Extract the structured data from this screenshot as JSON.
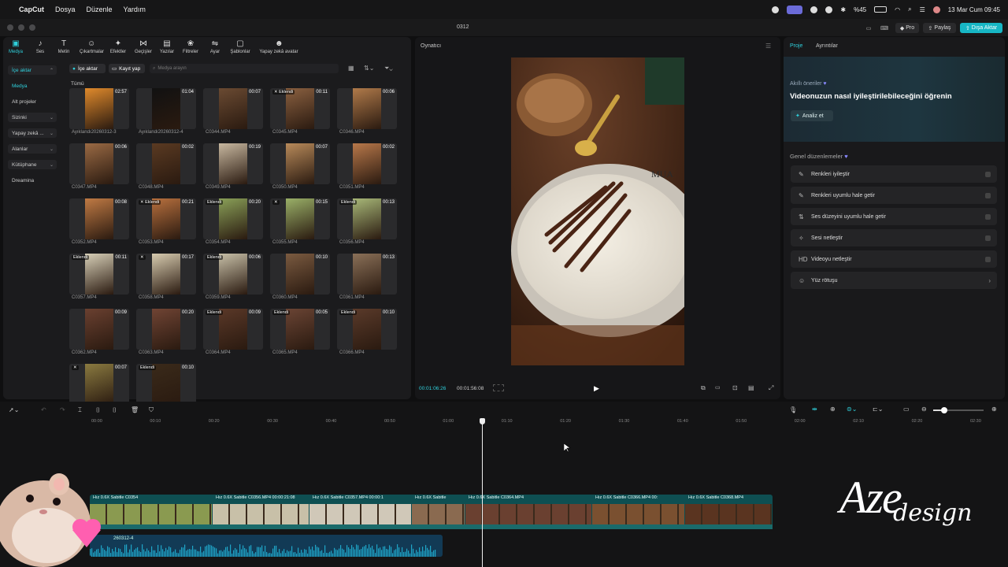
{
  "menubar": {
    "apple": "",
    "app_name": "CapCut",
    "items": [
      "Dosya",
      "Düzenle",
      "Yardım"
    ],
    "battery": "%45",
    "datetime": "13 Mar Cum  09:45"
  },
  "window": {
    "title": "0312",
    "pro_label": "Pro",
    "share_label": "Paylaş",
    "export_label": "Dışa Aktar"
  },
  "toolbar": {
    "tools": [
      {
        "label": "Medya",
        "icon": "▣"
      },
      {
        "label": "Ses",
        "icon": "♪"
      },
      {
        "label": "Metin",
        "icon": "T"
      },
      {
        "label": "Çıkartmalar",
        "icon": "☺"
      },
      {
        "label": "Efektler",
        "icon": "✦"
      },
      {
        "label": "Geçişler",
        "icon": "⋈"
      },
      {
        "label": "Yazılar",
        "icon": "▤"
      },
      {
        "label": "Filtreler",
        "icon": "❀"
      },
      {
        "label": "Ayar",
        "icon": "⇋"
      },
      {
        "label": "Şablonlar",
        "icon": "▢"
      },
      {
        "label": "Yapay zekâ avatar",
        "icon": "☻"
      }
    ]
  },
  "sidebar": {
    "items": [
      {
        "label": "İçe aktar",
        "arrow": "⌃"
      },
      {
        "label": "Medya",
        "arrow": ""
      },
      {
        "label": "Alt projeler",
        "arrow": ""
      },
      {
        "label": "Sizinki",
        "arrow": "⌄"
      },
      {
        "label": "Yapay zekâ ...",
        "arrow": "⌄"
      },
      {
        "label": "Alanlar",
        "arrow": "⌄"
      },
      {
        "label": "Kütüphane",
        "arrow": "⌄"
      },
      {
        "label": "Dreamina",
        "arrow": ""
      }
    ]
  },
  "media": {
    "import_label": "İçe aktar",
    "record_label": "Kayıt yap",
    "search_placeholder": "Medya arayın",
    "section_label": "Tümü",
    "items": [
      {
        "name": "Ayıklandı20260312-3",
        "dur": "02:57",
        "badge": "",
        "color": "#e08a2c"
      },
      {
        "name": "Ayıklandı20260312-4",
        "dur": "01:04",
        "badge": "",
        "color": "#111111"
      },
      {
        "name": "C0344.MP4",
        "dur": "00:07",
        "badge": "",
        "color": "#6a4a32"
      },
      {
        "name": "C0345.MP4",
        "dur": "00:11",
        "badge": "✕ Eklendi",
        "color": "#8a6040"
      },
      {
        "name": "C0346.MP4",
        "dur": "00:06",
        "badge": "",
        "color": "#b07a4a"
      },
      {
        "name": "C0347.MP4",
        "dur": "00:06",
        "badge": "",
        "color": "#9a6a44"
      },
      {
        "name": "C0348.MP4",
        "dur": "00:02",
        "badge": "",
        "color": "#5a3a22"
      },
      {
        "name": "C0349.MP4",
        "dur": "00:19",
        "badge": "",
        "color": "#c8b8a0"
      },
      {
        "name": "C0350.MP4",
        "dur": "00:07",
        "badge": "",
        "color": "#b88a5a"
      },
      {
        "name": "C0351.MP4",
        "dur": "00:02",
        "badge": "",
        "color": "#b8784a"
      },
      {
        "name": "C0352.MP4",
        "dur": "00:08",
        "badge": "",
        "color": "#c07a44"
      },
      {
        "name": "C0353.MP4",
        "dur": "00:21",
        "badge": "✕ Eklendi",
        "color": "#b8703e"
      },
      {
        "name": "C0354.MP4",
        "dur": "00:20",
        "badge": "Eklendi",
        "color": "#8aa058"
      },
      {
        "name": "C0355.MP4",
        "dur": "00:15",
        "badge": "✕",
        "color": "#9ab068"
      },
      {
        "name": "C0356.MP4",
        "dur": "00:13",
        "badge": "Eklendi",
        "color": "#a8b878"
      },
      {
        "name": "C0357.MP4",
        "dur": "00:11",
        "badge": "Eklendi",
        "color": "#d8d0b8"
      },
      {
        "name": "C0358.MP4",
        "dur": "00:17",
        "badge": "✕",
        "color": "#d8ccb0"
      },
      {
        "name": "C0359.MP4",
        "dur": "00:06",
        "badge": "Eklendi",
        "color": "#c8c0a8"
      },
      {
        "name": "C0360.MP4",
        "dur": "00:10",
        "badge": "",
        "color": "#7a5a40"
      },
      {
        "name": "C0361.MP4",
        "dur": "00:13",
        "badge": "",
        "color": "#8a7058"
      },
      {
        "name": "C0362.MP4",
        "dur": "00:09",
        "badge": "",
        "color": "#6a4030"
      },
      {
        "name": "C0363.MP4",
        "dur": "00:20",
        "badge": "",
        "color": "#704434"
      },
      {
        "name": "C0364.MP4",
        "dur": "00:09",
        "badge": "Eklendi",
        "color": "#5a3828"
      },
      {
        "name": "C0365.MP4",
        "dur": "00:05",
        "badge": "Eklendi",
        "color": "#6a4434"
      },
      {
        "name": "C0366.MP4",
        "dur": "00:10",
        "badge": "Eklendi",
        "color": "#5a3a2a"
      },
      {
        "name": "",
        "dur": "00:07",
        "badge": "✕",
        "color": "#8a7a40"
      },
      {
        "name": "",
        "dur": "00:10",
        "badge": "Eklendi",
        "color": "#3a2a1a"
      }
    ]
  },
  "player": {
    "title": "Oynatıcı",
    "current_time": "00:01:06:26",
    "total_time": "00:01:56:08"
  },
  "right_panel": {
    "tabs": [
      "Proje",
      "Ayrıntılar"
    ],
    "smart_label": "Akıllı öneriler",
    "smart_title": "Videonuzun nasıl iyileştirilebileceğini öğrenin",
    "analyze_label": "Analiz et",
    "general_label": "Genel düzenlemeler",
    "effects": [
      {
        "label": "Renkleri iyileştir",
        "icon": "✎",
        "trail": "toggle"
      },
      {
        "label": "Renkleri uyumlu hale getir",
        "icon": "✎",
        "trail": "toggle"
      },
      {
        "label": "Ses düzeyini uyumlu hale getir",
        "icon": "⇅",
        "trail": "toggle"
      },
      {
        "label": "Sesi netleştir",
        "icon": "✧",
        "trail": "toggle"
      },
      {
        "label": "Videoyu netleştir",
        "icon": "HD",
        "trail": "toggle"
      },
      {
        "label": "Yüz rötuşu",
        "icon": "☺",
        "trail": "›"
      }
    ]
  },
  "timeline": {
    "ticks": [
      "00:00",
      "00:10",
      "00:20",
      "00:30",
      "00:40",
      "00:50",
      "01:00",
      "01:10",
      "01:20",
      "01:30",
      "01:40",
      "01:50",
      "02:00",
      "02:10",
      "02:20",
      "02:30"
    ],
    "clip_labels": [
      "Hız 0.6X  Sabitle  C0354",
      "Hız 0.6X  Sabitle  C0356.MP4  00:00:21:08",
      "Hız 0.6X  Sabitle  C0357.MP4  00:00:1",
      "Hız 0.6X  Sabitle",
      "Hız 0.6X  Sabitle  C0364.MP4",
      "Hız 0.6X  Sabitle  C0366.MP4  00:",
      "Hız 0.6X  Sabitle  C0368.MP4"
    ],
    "audio_label": "260312-4"
  },
  "watermark": {
    "text_main": "Aze",
    "text_script": "design"
  }
}
